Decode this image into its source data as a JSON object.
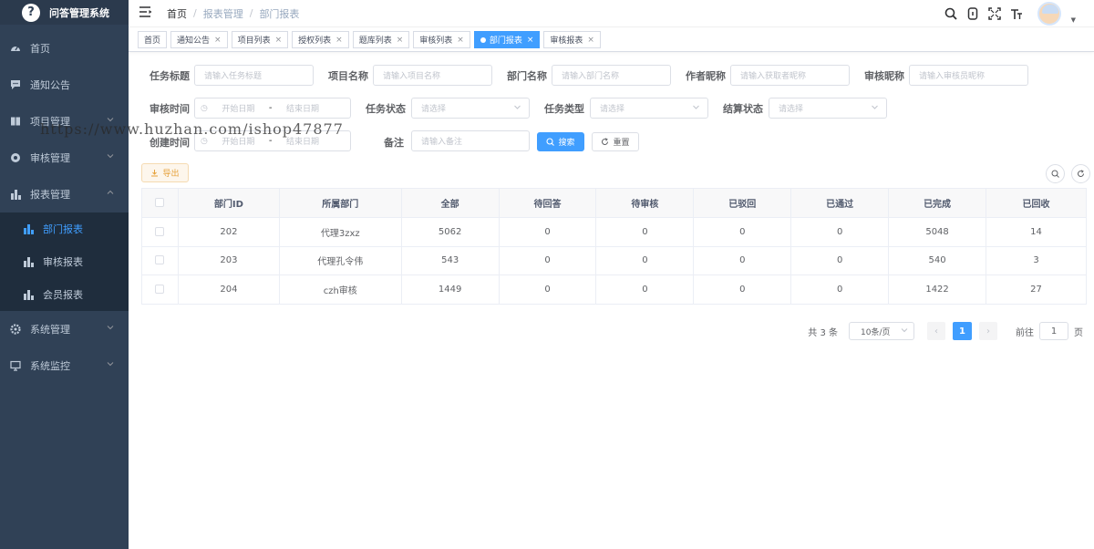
{
  "app": {
    "title": "问答管理系统",
    "logo_glyph": "?"
  },
  "sidebar": {
    "items": [
      {
        "label": "首页",
        "icon": "dashboard-icon"
      },
      {
        "label": "通知公告",
        "icon": "message-icon"
      },
      {
        "label": "项目管理",
        "icon": "book-icon"
      },
      {
        "label": "审核管理",
        "icon": "gear-circle-icon"
      },
      {
        "label": "报表管理",
        "icon": "bar-chart-icon"
      }
    ],
    "sub_items": [
      {
        "label": "部门报表",
        "active": true
      },
      {
        "label": "审核报表"
      },
      {
        "label": "会员报表"
      }
    ],
    "bottom_items": [
      {
        "label": "系统管理",
        "icon": "settings-icon"
      },
      {
        "label": "系统监控",
        "icon": "monitor-icon"
      }
    ]
  },
  "breadcrumb": [
    "首页",
    "报表管理",
    "部门报表"
  ],
  "tags": [
    "首页",
    "通知公告",
    "项目列表",
    "授权列表",
    "题库列表",
    "审核列表",
    "部门报表",
    "审核报表"
  ],
  "form": {
    "task_title": {
      "label": "任务标题",
      "placeholder": "请输入任务标题"
    },
    "project_name": {
      "label": "项目名称",
      "placeholder": "请输入项目名称"
    },
    "dept_name": {
      "label": "部门名称",
      "placeholder": "请输入部门名称"
    },
    "author_nick": {
      "label": "作者昵称",
      "placeholder": "请输入获取者昵称"
    },
    "reviewer_nick": {
      "label": "审核昵称",
      "placeholder": "请输入审核员昵称"
    },
    "review_time": {
      "label": "审核时间",
      "start": "开始日期",
      "end": "结束日期",
      "sep": "-"
    },
    "task_status": {
      "label": "任务状态",
      "placeholder": "请选择"
    },
    "task_type": {
      "label": "任务类型",
      "placeholder": "请选择"
    },
    "settle_status": {
      "label": "结算状态",
      "placeholder": "请选择"
    },
    "create_time": {
      "label": "创建时间",
      "start": "开始日期",
      "end": "结束日期",
      "sep": "-"
    },
    "remark": {
      "label": "备注",
      "placeholder": "请输入备注"
    },
    "search_btn": "搜索",
    "reset_btn": "重置",
    "export_btn": "导出"
  },
  "watermark": "https://www.huzhan.com/ishop47877",
  "table": {
    "columns": [
      "部门ID",
      "所属部门",
      "全部",
      "待回答",
      "待审核",
      "已驳回",
      "已通过",
      "已完成",
      "已回收"
    ],
    "rows": [
      [
        "202",
        "代理3zxz",
        "5062",
        "0",
        "0",
        "0",
        "0",
        "5048",
        "14"
      ],
      [
        "203",
        "代理孔令伟",
        "543",
        "0",
        "0",
        "0",
        "0",
        "540",
        "3"
      ],
      [
        "204",
        "czh审核",
        "1449",
        "0",
        "0",
        "0",
        "0",
        "1422",
        "27"
      ]
    ]
  },
  "pagination": {
    "total": "共 3 条",
    "page_size": "10条/页",
    "current_page": "1",
    "goto_label": "前往",
    "goto_value": "1",
    "page_suffix": "页"
  },
  "colors": {
    "sidebar_bg": "#304156",
    "primary": "#409eff",
    "warning": "#e6a23c"
  }
}
